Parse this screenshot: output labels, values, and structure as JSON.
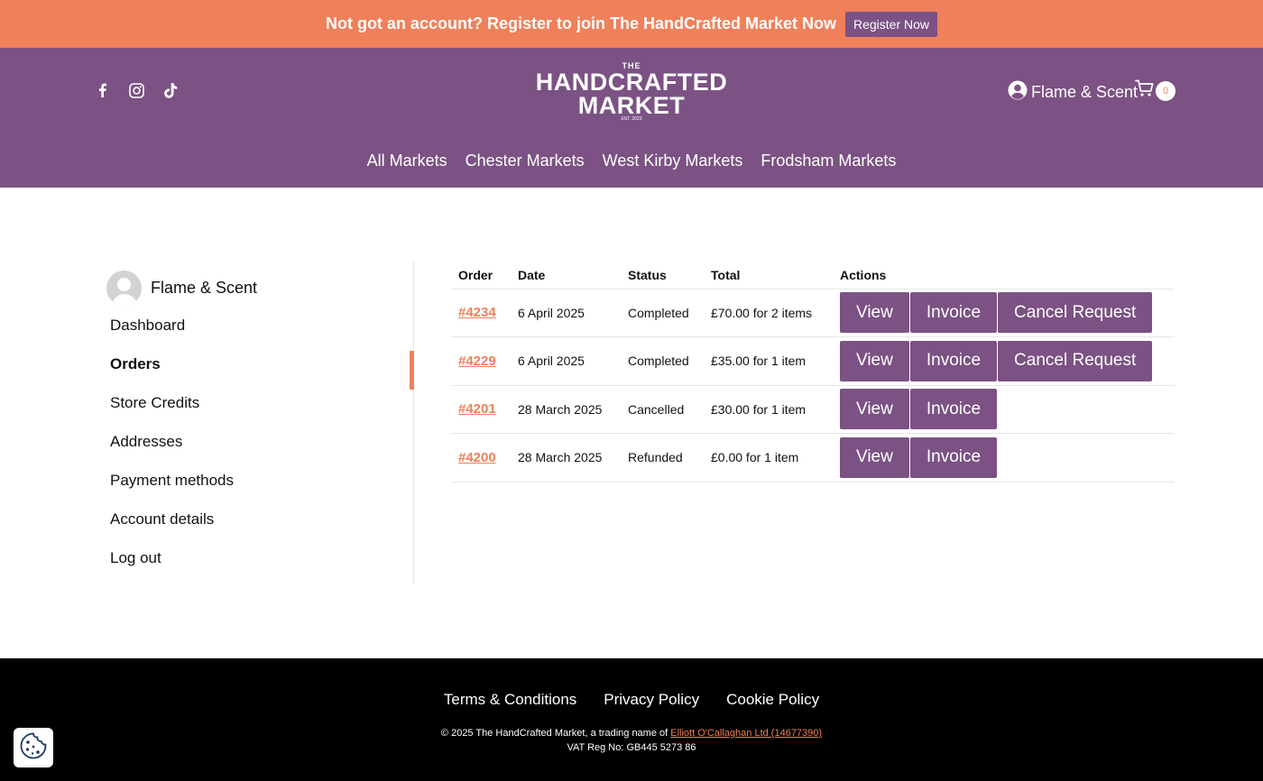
{
  "banner": {
    "text": "Not got an account? Register to join The HandCrafted Market Now",
    "button": "Register Now"
  },
  "header": {
    "socials": [
      "facebook-icon",
      "instagram-icon",
      "tiktok-icon"
    ],
    "logo": {
      "the": "THE",
      "line1": "HANDCRAFTED",
      "line2": "MARKET",
      "est": "EST. 2023"
    },
    "account_name": "Flame & Scent",
    "cart_count": "0",
    "nav": [
      "All Markets",
      "Chester Markets",
      "West Kirby Markets",
      "Frodsham Markets"
    ]
  },
  "sidebar": {
    "user_name": "Flame & Scent",
    "items": [
      "Dashboard",
      "Orders",
      "Store Credits",
      "Addresses",
      "Payment methods",
      "Account details",
      "Log out"
    ],
    "active": "Orders"
  },
  "orders": {
    "headers": [
      "Order",
      "Date",
      "Status",
      "Total",
      "Actions"
    ],
    "rows": [
      {
        "order": "#4234",
        "date": "6 April 2025",
        "status": "Completed",
        "total": "£70.00 for 2 items",
        "actions": [
          "View",
          "Invoice",
          "Cancel Request"
        ]
      },
      {
        "order": "#4229",
        "date": "6 April 2025",
        "status": "Completed",
        "total": "£35.00 for 1 item",
        "actions": [
          "View",
          "Invoice",
          "Cancel Request"
        ]
      },
      {
        "order": "#4201",
        "date": "28 March 2025",
        "status": "Cancelled",
        "total": "£30.00 for 1 item",
        "actions": [
          "View",
          "Invoice"
        ]
      },
      {
        "order": "#4200",
        "date": "28 March 2025",
        "status": "Refunded",
        "total": "£0.00 for 1 item",
        "actions": [
          "View",
          "Invoice"
        ]
      }
    ]
  },
  "footer": {
    "links": [
      "Terms & Conditions",
      "Privacy Policy",
      "Cookie Policy"
    ],
    "copyright_prefix": "© 2025 The HandCrafted Market, a trading name of",
    "company_link": "Elliott O'Callaghan Ltd (14677390)",
    "vat": "VAT Reg No: GB445 5273 86"
  },
  "colors": {
    "accent": "#f0805a",
    "brand": "#7b5283",
    "footer": "#000000"
  }
}
